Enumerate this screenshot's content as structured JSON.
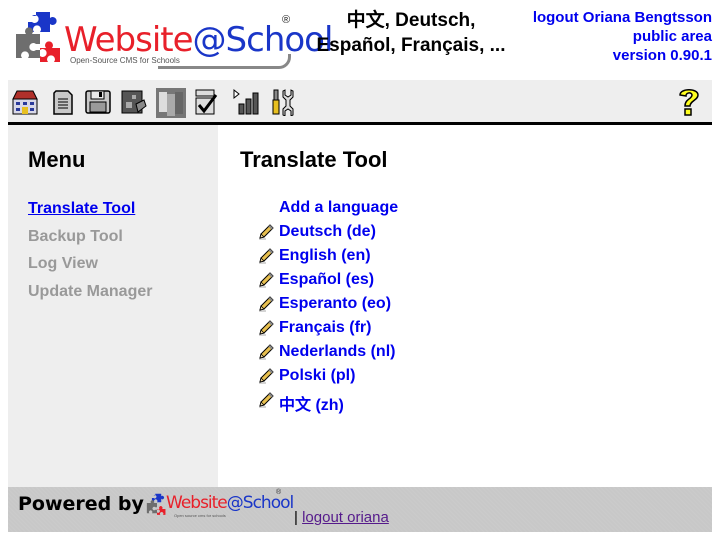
{
  "header": {
    "logo": {
      "word_red": "Website",
      "word_blue": "@School",
      "tagline": "Open-Source CMS for Schools",
      "registered": "®"
    },
    "languages_line1": "中文, Deutsch,",
    "languages_line2": "Español, Français, ...",
    "user": {
      "logout_label": "logout Oriana Bengtsson",
      "area_label": "public area",
      "version_label": "version 0.90.1"
    }
  },
  "toolbar": {
    "icons": [
      {
        "name": "home-icon",
        "title": "Start"
      },
      {
        "name": "page-icon",
        "title": "Page manager"
      },
      {
        "name": "floppy-disk-icon",
        "title": "File manager"
      },
      {
        "name": "modules-icon",
        "title": "Modules"
      },
      {
        "name": "users-icon",
        "title": "Account manager"
      },
      {
        "name": "configuration-icon",
        "title": "Configuration"
      },
      {
        "name": "statistics-icon",
        "title": "Statistics"
      },
      {
        "name": "tools-icon",
        "title": "Tools"
      }
    ],
    "help_icon": "help-icon"
  },
  "sidebar": {
    "title": "Menu",
    "items": [
      {
        "label": "Translate Tool",
        "active": true
      },
      {
        "label": "Backup Tool",
        "active": false
      },
      {
        "label": "Log View",
        "active": false
      },
      {
        "label": "Update Manager",
        "active": false
      }
    ]
  },
  "main": {
    "title": "Translate Tool",
    "add_language_label": "Add a language",
    "languages": [
      {
        "label": "Deutsch (de)"
      },
      {
        "label": "English (en)"
      },
      {
        "label": "Español (es)"
      },
      {
        "label": "Esperanto (eo)"
      },
      {
        "label": "Français (fr)"
      },
      {
        "label": "Nederlands (nl)"
      },
      {
        "label": "Polski (pl)"
      },
      {
        "label": "中文 (zh)"
      }
    ]
  },
  "footer": {
    "powered_by": "Powered by",
    "logo_red": "Website",
    "logo_blue": "@School",
    "logo_tagline": "Open source cms for schools",
    "registered": "®",
    "separator": "|",
    "logout_link": "logout oriana"
  },
  "colors": {
    "link": "#0000ee",
    "disabled_menu": "#999999",
    "panel_bg": "#eeeeee",
    "footer_bg": "#c8c8c8",
    "brand_red": "#e8202a",
    "brand_blue": "#1a36c8"
  }
}
